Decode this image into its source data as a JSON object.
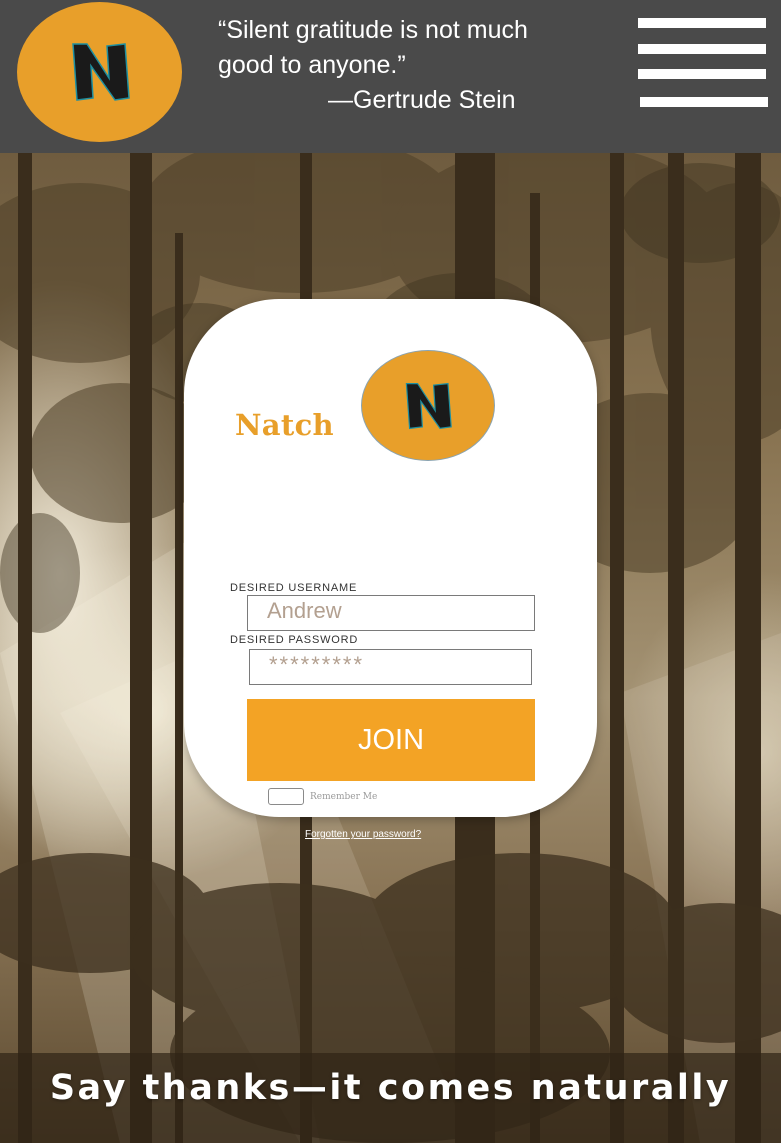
{
  "header": {
    "logo_icon": "natch-n-logo",
    "quote_text": "“Silent gratitude is not much good to anyone.”",
    "quote_author": "—Gertrude Stein",
    "menu_icon": "hamburger-menu-icon"
  },
  "login_card": {
    "brand_name": "Natch",
    "logo_icon": "natch-n-logo",
    "username_label": "DESIRED USERNAME",
    "username_value": "Andrew",
    "password_label": "DESIRED PASSWORD",
    "password_value": "*********",
    "join_label": "JOIN",
    "remember_label": "Remember Me"
  },
  "forgot_password_label": "Forgotten your password?",
  "tagline": "Say thanks—it comes naturally",
  "colors": {
    "header_bg": "#4a4a4a",
    "brand_orange": "#e89f2a",
    "join_button": "#f3a325",
    "card_bg": "#ffffff"
  }
}
